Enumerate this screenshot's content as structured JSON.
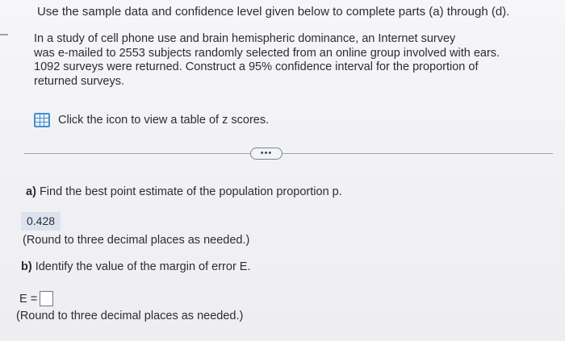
{
  "intro": "Use the sample data and confidence level given below to complete parts (a) through (d).",
  "problem_lines": [
    "In a study of cell phone use and brain hemispheric dominance, an Internet survey",
    "was e-mailed to 2553 subjects randomly selected from an online group involved with ears.",
    "1092 surveys were returned. Construct a 95% confidence interval for the proportion of",
    "returned surveys."
  ],
  "z_table": {
    "icon": "table-grid-icon",
    "label": "Click the icon to view a table of z scores."
  },
  "more_button": "•••",
  "part_a": {
    "label": "a)",
    "question": "Find the best point estimate of the population proportion p.",
    "answer": "0.428",
    "hint": "(Round to three decimal places as needed.)"
  },
  "part_b": {
    "label": "b)",
    "question": "Identify the value of the margin of error E.",
    "input_label": "E =",
    "input_value": "",
    "hint": "(Round to three decimal places as needed.)"
  },
  "colors": {
    "text": "#2a2d33",
    "icon_blue": "#4a8fd0",
    "answer_highlight": "#dde3ee"
  }
}
